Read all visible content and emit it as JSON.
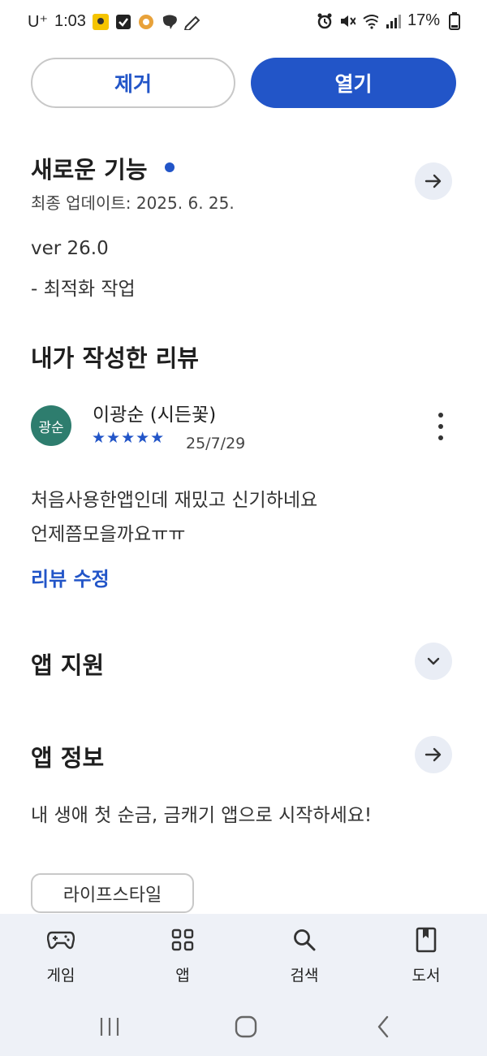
{
  "status_bar": {
    "carrier": "U⁺",
    "time": "1:03",
    "battery": "17%"
  },
  "actions": {
    "remove_label": "제거",
    "open_label": "열기"
  },
  "whats_new": {
    "title": "새로운 기능",
    "last_updated": "최종 업데이트: 2025. 6. 25.",
    "version": "ver 26.0",
    "note": "- 최적화 작업"
  },
  "my_review": {
    "title": "내가 작성한 리뷰",
    "avatar_text": "광순",
    "reviewer": "이광순 (시든꽃)",
    "rating": 5,
    "stars": "★★★★★",
    "date": "25/7/29",
    "text_line1": "처음사용한앱인데 재밌고 신기하네요",
    "text_line2": "언제쯤모을까요ㅠㅠ",
    "edit_label": "리뷰 수정"
  },
  "app_support": {
    "title": "앱 지원"
  },
  "app_info": {
    "title": "앱 정보",
    "description": "내 생애 첫 순금, 금캐기 앱으로 시작하세요!",
    "category": "라이프스타일"
  },
  "bottom_nav": {
    "items": [
      {
        "label": "게임",
        "icon": "gamepad-icon"
      },
      {
        "label": "앱",
        "icon": "apps-grid-icon"
      },
      {
        "label": "검색",
        "icon": "search-icon"
      },
      {
        "label": "도서",
        "icon": "book-icon"
      }
    ]
  },
  "colors": {
    "accent": "#2255c8",
    "avatar": "#2e7d6e",
    "nav_bg": "#eef1f7"
  }
}
